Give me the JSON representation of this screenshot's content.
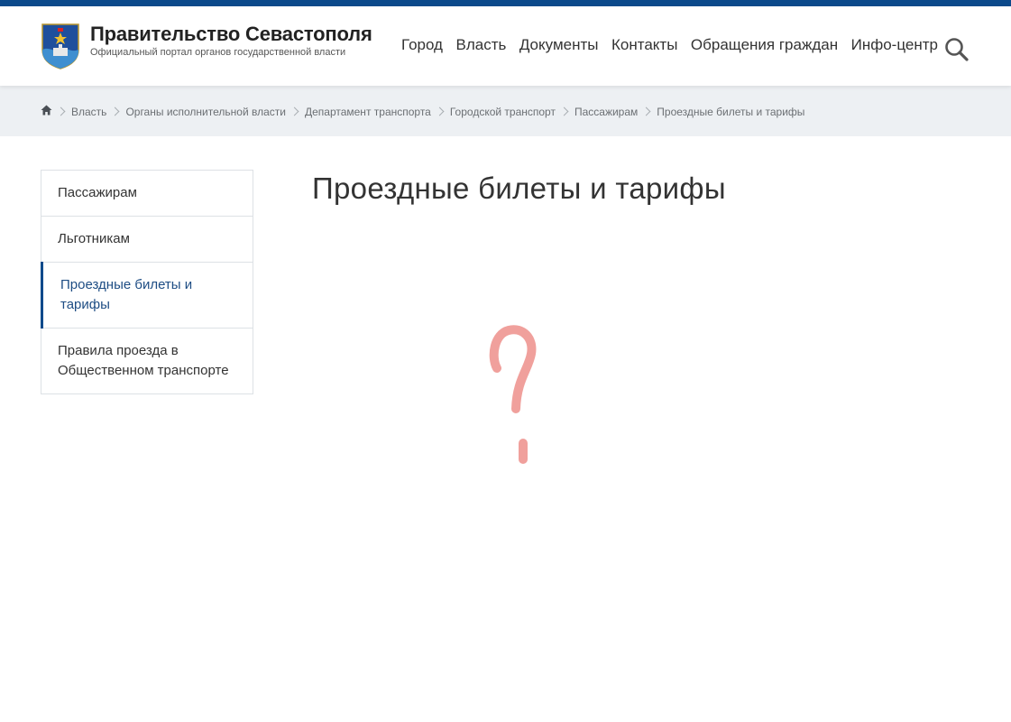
{
  "header": {
    "logo_title": "Правительство Севастополя",
    "logo_subtitle": "Официальный портал органов государственной власти",
    "nav": [
      "Город",
      "Власть",
      "Документы",
      "Контакты",
      "Обращения граждан",
      "Инфо-центр"
    ],
    "search_icon": "search-icon",
    "brand_color": "#0b4a8b"
  },
  "breadcrumb": {
    "home_icon": "home-icon",
    "items": [
      "Власть",
      "Органы исполнительной власти",
      "Департамент транспорта",
      "Городской транспорт",
      "Пассажирам",
      "Проездные билеты и тарифы"
    ]
  },
  "sidebar": {
    "items": [
      {
        "label": "Пассажирам",
        "active": false
      },
      {
        "label": "Льготникам",
        "active": false
      },
      {
        "label": "Проездные билеты и тарифы",
        "active": true
      },
      {
        "label": "Правила проезда в Общественном транспорте",
        "active": false
      }
    ]
  },
  "main": {
    "title": "Проездные билеты и тарифы",
    "placeholder_icon": "question-mark-icon",
    "placeholder_color": "#f0a09c"
  }
}
